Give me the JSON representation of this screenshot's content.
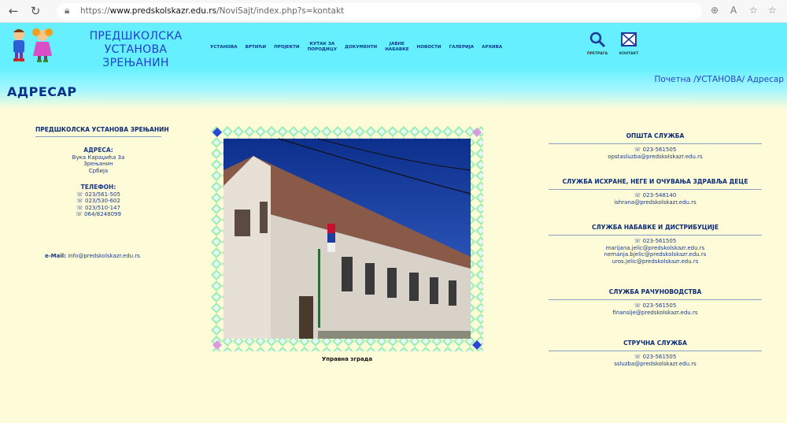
{
  "browser": {
    "url_prefix": "https://",
    "url_domain": "www.predskolskazr.edu.rs",
    "url_path": "/NoviSajt/index.php?s=kontakt"
  },
  "header": {
    "title_line1": "ПРЕДШКОЛСКА УСТАНОВА",
    "title_line2": "ЗРЕЊАНИН"
  },
  "menu": [
    {
      "label": "УСТАНОВА"
    },
    {
      "label": "ВРТИЋИ"
    },
    {
      "label": "ПРОЈЕКТИ"
    },
    {
      "label": "КУТАК ЗА\nПОРОДИЦУ"
    },
    {
      "label": "ДОКУМЕНТИ"
    },
    {
      "label": "ЈАВНЕ\nНАБАВКЕ"
    },
    {
      "label": "НОВОСТИ"
    },
    {
      "label": "ГАЛЕРИЈА"
    },
    {
      "label": "АРХИВА"
    }
  ],
  "tools": {
    "search_label": "ПРЕТРАГА",
    "contact_label": "КОНТАКТ"
  },
  "page": {
    "title": "АДРЕСАР",
    "breadcrumb": "Почетна /УСТАНОВА/ Адресар"
  },
  "institution": {
    "name": "ПРЕДШКОЛСКА УСТАНОВА ЗРЕЊАНИН",
    "address_label": "АДРЕСА:",
    "address_lines": [
      "Вука Караџића 3а",
      "Зрењанин",
      "Србија"
    ],
    "phone_label": "ТЕЛЕФОН:",
    "phones": [
      "☏ 023/561-505",
      "☏ 023/530-602",
      "☏ 023/510-147",
      "☏ 064/8248099"
    ],
    "email_label": "e-Mail:",
    "email": "info@predskolskazr.edu.rs"
  },
  "photo": {
    "caption": "Управна зграда"
  },
  "services": [
    {
      "title": "ОПШТА СЛУЖБА",
      "lines": [
        "☏ 023-561505",
        "opstasluzba@predskolskazr.edu.rs"
      ]
    },
    {
      "title": "СЛУЖБА ИСХРАНЕ, НЕГЕ И ОЧУВАЊА ЗДРАВЉА ДЕЦЕ",
      "lines": [
        "☏ 023-548140",
        "ishrana@predskolskazr.edu.rs"
      ]
    },
    {
      "title": "СЛУЖБА НАБАВКЕ И ДИСТРИБУЦИЈЕ",
      "lines": [
        "☏ 023-561505",
        "marijana.jelic@predskolskazr.edu.rs",
        "nemanja.bjelic@predskolskazr.edu.rs",
        "uros.jelic@predskolskazr.edu.rs"
      ]
    },
    {
      "title": "СЛУЖБА РАЧУНОВОДСТВА",
      "lines": [
        "☏ 023-561505",
        "finansije@predskolskazr.edu.rs"
      ]
    },
    {
      "title": "СТРУЧНА СЛУЖБА",
      "lines": [
        "☏ 023-561505",
        "ssluzba@predskolskazr.edu.rs"
      ]
    }
  ],
  "colors": {
    "header_bg": "#66f0ff",
    "page_bg": "#fdfbd8",
    "title_blue": "#1f3fd0"
  }
}
